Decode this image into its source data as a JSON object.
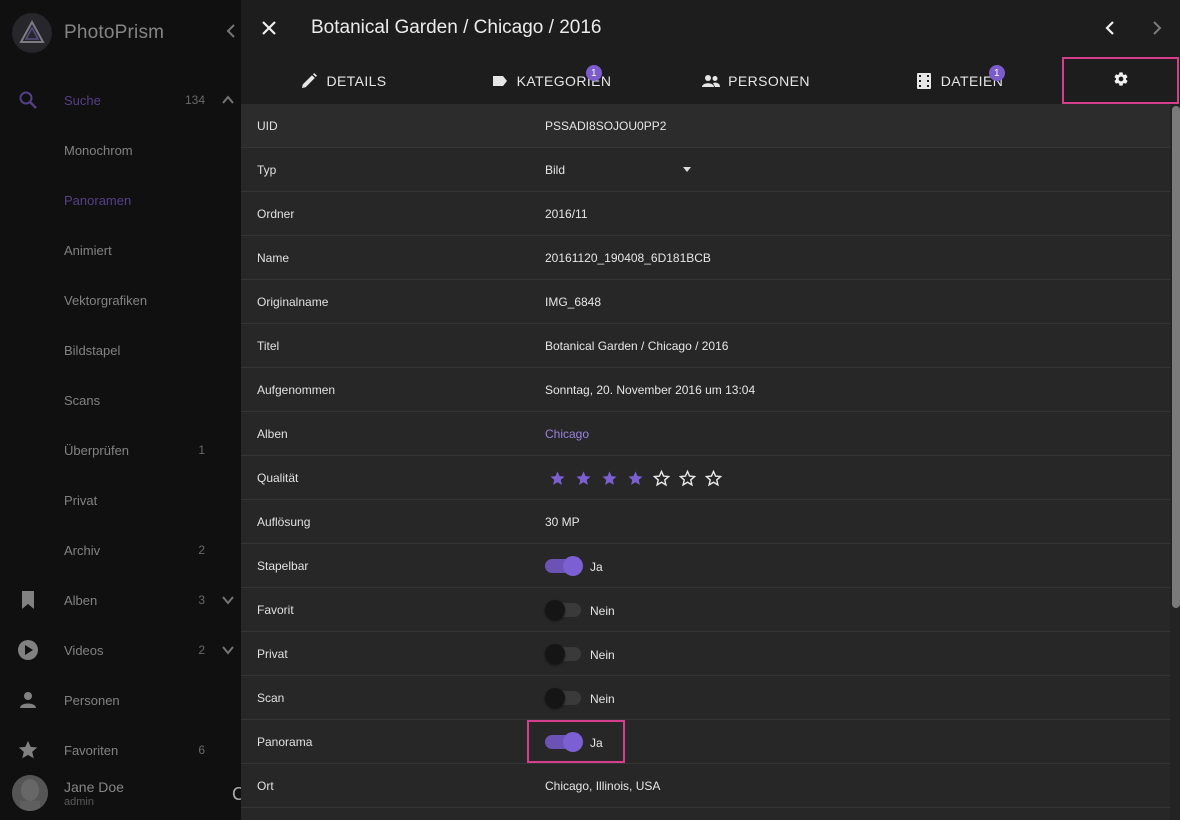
{
  "app": {
    "name": "PhotoPrism"
  },
  "sidebar": {
    "items": [
      {
        "label": "Suche",
        "count": "134",
        "icon": "search-icon",
        "active": true
      },
      {
        "label": "Monochrom",
        "count": ""
      },
      {
        "label": "Panoramen",
        "count": "",
        "selected": true
      },
      {
        "label": "Animiert",
        "count": ""
      },
      {
        "label": "Vektorgrafiken",
        "count": ""
      },
      {
        "label": "Bildstapel",
        "count": ""
      },
      {
        "label": "Scans",
        "count": ""
      },
      {
        "label": "Überprüfen",
        "count": "1"
      },
      {
        "label": "Privat",
        "count": ""
      },
      {
        "label": "Archiv",
        "count": "2"
      },
      {
        "label": "Alben",
        "count": "3",
        "icon": "bookmark-icon"
      },
      {
        "label": "Videos",
        "count": "2",
        "icon": "play-circle-icon"
      },
      {
        "label": "Personen",
        "count": "",
        "icon": "person-icon"
      },
      {
        "label": "Favoriten",
        "count": "6",
        "icon": "star-icon"
      }
    ],
    "user": {
      "name": "Jane Doe",
      "role": "admin"
    }
  },
  "dialog": {
    "title": "Botanical Garden / Chicago / 2016",
    "tabs": [
      {
        "label": "DETAILS",
        "icon": "pencil-icon",
        "badge": ""
      },
      {
        "label": "KATEGORIEN",
        "icon": "label-icon",
        "badge": "1"
      },
      {
        "label": "PERSONEN",
        "icon": "people-icon",
        "badge": ""
      },
      {
        "label": "DATEIEN",
        "icon": "film-icon",
        "badge": "1"
      },
      {
        "label": "",
        "icon": "gear-icon",
        "badge": "",
        "active": true
      }
    ],
    "fields": {
      "uid": {
        "label": "UID",
        "value": "PSSADI8SOJOU0PP2"
      },
      "type": {
        "label": "Typ",
        "value": "Bild"
      },
      "folder": {
        "label": "Ordner",
        "value": "2016/11"
      },
      "name": {
        "label": "Name",
        "value": "20161120_190408_6D181BCB"
      },
      "original_name": {
        "label": "Originalname",
        "value": "IMG_6848"
      },
      "title": {
        "label": "Titel",
        "value": "Botanical Garden / Chicago / 2016"
      },
      "taken": {
        "label": "Aufgenommen",
        "value": "Sonntag, 20. November 2016 um 13:04"
      },
      "albums": {
        "label": "Alben",
        "value": "Chicago"
      },
      "quality": {
        "label": "Qualität",
        "rating": 4,
        "max": 7
      },
      "resolution": {
        "label": "Auflösung",
        "value": "30 MP"
      },
      "stackable": {
        "label": "Stapelbar",
        "on": true,
        "value": "Ja"
      },
      "favorite": {
        "label": "Favorit",
        "on": false,
        "value": "Nein"
      },
      "private": {
        "label": "Privat",
        "on": false,
        "value": "Nein"
      },
      "scan": {
        "label": "Scan",
        "on": false,
        "value": "Nein"
      },
      "panorama": {
        "label": "Panorama",
        "on": true,
        "value": "Ja"
      },
      "location": {
        "label": "Ort",
        "value": "Chicago, Illinois, USA"
      }
    }
  },
  "colors": {
    "accent": "#7d5fd4",
    "highlight": "#d63d8e"
  }
}
